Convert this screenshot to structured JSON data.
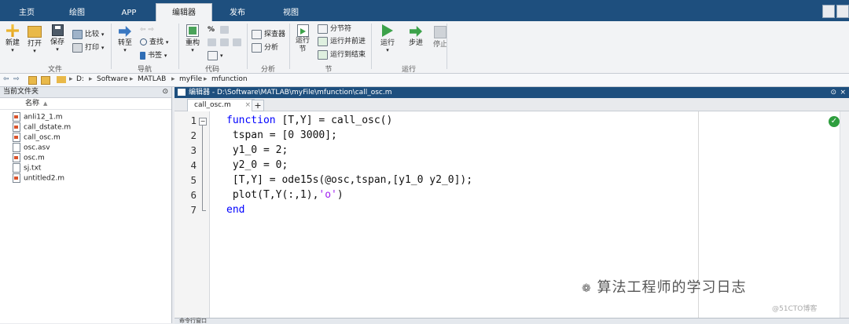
{
  "tabs": [
    {
      "label": "主页"
    },
    {
      "label": "绘图"
    },
    {
      "label": "APP"
    },
    {
      "label": "编辑器"
    },
    {
      "label": "发布"
    },
    {
      "label": "视图"
    }
  ],
  "ribbon": {
    "file": {
      "new": "新建",
      "open": "打开",
      "save": "保存",
      "compare": "比较",
      "print": "打印",
      "group": "文件"
    },
    "nav": {
      "goto": "转至",
      "find": "查找",
      "bookmark": "书签",
      "group": "导航"
    },
    "code": {
      "refactor": "重构",
      "group": "代码"
    },
    "analyze": {
      "profiler": "探查器",
      "analyze": "分析",
      "group": "分析"
    },
    "section": {
      "run_section": "运行节",
      "section_break": "分节符",
      "run_advance": "运行并前进",
      "run_to_end": "运行到结束",
      "group": "节"
    },
    "run": {
      "run": "运行",
      "step": "步进",
      "stop": "停止",
      "group": "运行"
    }
  },
  "address": {
    "path": [
      "D:",
      "Software",
      "MATLAB",
      "myFile",
      "mfunction"
    ]
  },
  "left_panel": {
    "title": "当前文件夹",
    "column": "名称",
    "files": [
      {
        "name": "anli12_1.m",
        "type": "m"
      },
      {
        "name": "call_dstate.m",
        "type": "m"
      },
      {
        "name": "call_osc.m",
        "type": "m"
      },
      {
        "name": "osc.asv",
        "type": "file"
      },
      {
        "name": "osc.m",
        "type": "m"
      },
      {
        "name": "sj.txt",
        "type": "file"
      },
      {
        "name": "untitled2.m",
        "type": "m"
      }
    ]
  },
  "editor": {
    "title": "编辑器 - D:\\Software\\MATLAB\\myFile\\mfunction\\call_osc.m",
    "tab": "call_osc.m",
    "lines": [
      {
        "n": "1",
        "parts": [
          {
            "t": "function",
            "c": "kw"
          },
          {
            "t": " [T,Y] = call_osc()",
            "c": ""
          }
        ]
      },
      {
        "n": "2",
        "parts": [
          {
            "t": " tspan = [0 3000];",
            "c": ""
          }
        ]
      },
      {
        "n": "3",
        "parts": [
          {
            "t": " y1_0 = 2;",
            "c": ""
          }
        ]
      },
      {
        "n": "4",
        "parts": [
          {
            "t": " y2_0 = 0;",
            "c": ""
          }
        ]
      },
      {
        "n": "5",
        "parts": [
          {
            "t": " [T,Y] = ode15s(@osc,tspan,[y1_0 y2_0]);",
            "c": ""
          }
        ]
      },
      {
        "n": "6",
        "parts": [
          {
            "t": " plot(T,Y(:,1),",
            "c": ""
          },
          {
            "t": "'o'",
            "c": "str"
          },
          {
            "t": ")",
            "c": ""
          }
        ]
      },
      {
        "n": "7",
        "parts": [
          {
            "t": "end",
            "c": "kw"
          }
        ]
      }
    ]
  },
  "cmd_window": {
    "title": "命令行窗口"
  },
  "watermark": {
    "text": "算法工程师的学习日志",
    "sub": "@51CTO博客"
  }
}
